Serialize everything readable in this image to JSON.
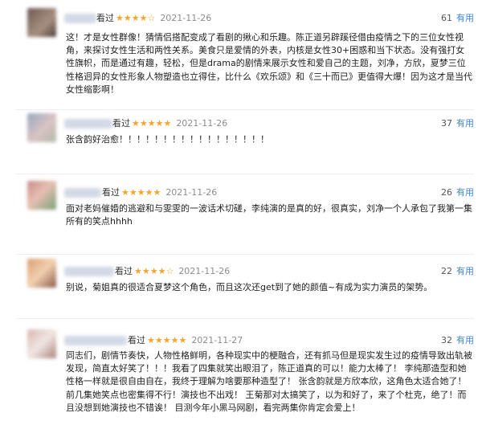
{
  "reviews": [
    {
      "seen": "看过",
      "stars": "★★★★☆",
      "date": "2021-11-26",
      "useful_count": "61",
      "useful_label": "有用",
      "text": "这！才是女性群像！猜情侣搭配变成了看剧的揪心和乐趣。陈正道另辟蹊径借由疫情之下的三位女性视角，来探讨女性生活和两性关系。美食只是爱情的外表，内核是女性30+困惑和当下状态。没有强打女性旗帜，而是通过有趣，轻松，但是drama的剧情来展示女性和爱自己的主题，刘净，方欣，夏梦三位性格迥异的女性形象人物塑造也立得住，比什么《欢乐颂》和《三十而已》更值得大爆！因为这才是当代女性缩影啊！",
      "avatar_colors": [
        "#6b5a52",
        "#a89080"
      ]
    },
    {
      "seen": "看过",
      "stars": "★★★★★",
      "date": "2021-11-26",
      "useful_count": "37",
      "useful_label": "有用",
      "text": "张含韵好治愈！！！！！！！！！！！！！！！！！",
      "avatar_colors": [
        "#9aa7c0",
        "#d9c4c4"
      ]
    },
    {
      "seen": "看过",
      "stars": "★★★★★",
      "date": "2021-11-26",
      "useful_count": "26",
      "useful_label": "有用",
      "text": "面对老妈催婚的逃避和与雯雯的一波话术切磋，李纯演的是真的好，很真实，刘净一个人承包了我第一集所有的笑点hhhh",
      "avatar_colors": [
        "#c98a8a",
        "#7aa07a"
      ]
    },
    {
      "seen": "看过",
      "stars": "★★★★☆",
      "date": "2021-11-26",
      "useful_count": "22",
      "useful_label": "有用",
      "text": "别说，菊姐真的很适合夏梦这个角色，而且这次还get到了她的颜值~有成为实力演员的架势。",
      "avatar_colors": [
        "#d9a070",
        "#8a5a48"
      ]
    },
    {
      "seen": "看过",
      "stars": "★★★★★",
      "date": "2021-11-27",
      "useful_count": "32",
      "useful_label": "有用",
      "text": "同志们，剧情节奏快，人物性格鲜明，各种现实中的梗融合，还有抓马但是现实发生过的疫情导致出轨被发现，简直太好笑了！！！我看了四集就笑出眼泪了，陈正道真的可以！能力太棒了！ 李纯那造型和她性格一样就是很自由自在，我终于理解为啥要那种造型了！ 张含韵就是方欣本欣，这角色太适合她了！前几集她笑点也密集得不行！演技也不出戏！ 王菊那对太搞笑了，以为和好了，来了个杜克，绝了！而且没想到她演技也不错诶！ 目测今年小黑马网剧，看完两集你肯定会爱上！",
      "avatar_colors": [
        "#d8b8b0",
        "#f0e6e4"
      ]
    }
  ]
}
